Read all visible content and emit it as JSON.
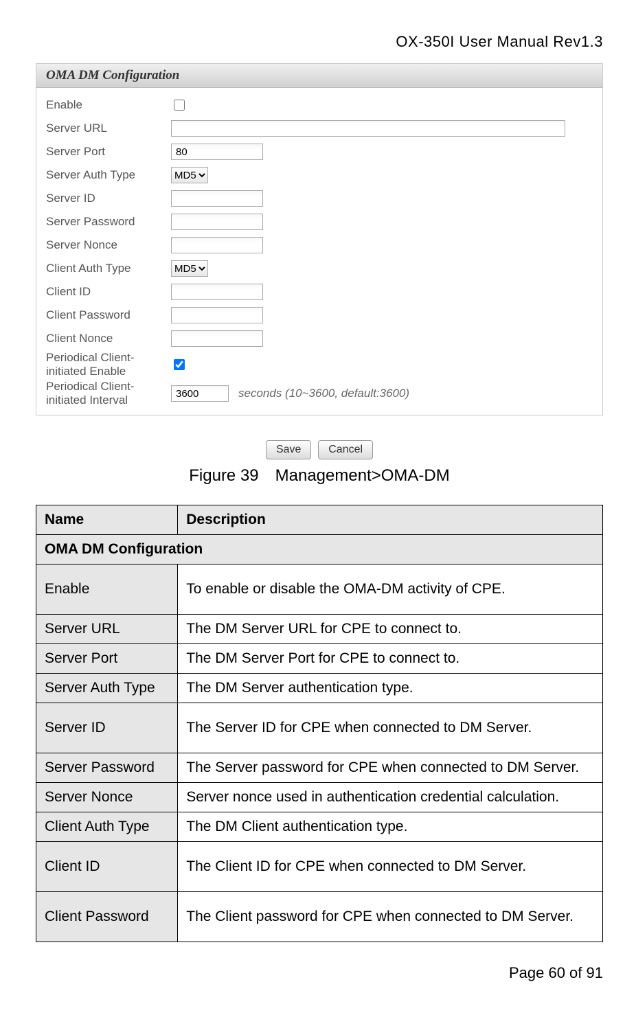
{
  "header": "OX-350I User Manual Rev1.3",
  "panel": {
    "title": "OMA DM Configuration",
    "rows": [
      {
        "label": "Enable"
      },
      {
        "label": "Server URL"
      },
      {
        "label": "Server Port",
        "value": "80"
      },
      {
        "label": "Server Auth Type",
        "select": "MD5"
      },
      {
        "label": "Server ID"
      },
      {
        "label": "Server Password"
      },
      {
        "label": "Server Nonce"
      },
      {
        "label": "Client Auth Type",
        "select": "MD5"
      },
      {
        "label": "Client ID"
      },
      {
        "label": "Client Password"
      },
      {
        "label": "Client Nonce"
      },
      {
        "label": "Periodical Client-initiated Enable"
      },
      {
        "label": "Periodical Client-initiated Interval",
        "value": "3600",
        "hint": "seconds (10~3600, default:3600)"
      }
    ],
    "buttons": {
      "save": "Save",
      "cancel": "Cancel"
    }
  },
  "caption": "Figure 39 Management>OMA-DM",
  "table": {
    "headers": {
      "name": "Name",
      "desc": "Description"
    },
    "section": "OMA DM Configuration",
    "rows": [
      {
        "name": "Enable",
        "desc": "To enable or disable the OMA-DM activity of CPE."
      },
      {
        "name": "Server URL",
        "desc": "The DM Server URL for CPE to connect to."
      },
      {
        "name": "Server Port",
        "desc": "The DM Server Port for CPE to connect to."
      },
      {
        "name": "Server Auth Type",
        "desc": "The DM Server authentication type."
      },
      {
        "name": "Server ID",
        "desc": "The Server ID for CPE when connected to DM Server."
      },
      {
        "name": "Server Password",
        "desc": "The Server password for CPE when connected to DM Server."
      },
      {
        "name": "Server Nonce",
        "desc": "Server nonce used in authentication credential calculation."
      },
      {
        "name": "Client Auth Type",
        "desc": "The DM Client authentication type."
      },
      {
        "name": "Client ID",
        "desc": "The Client ID for CPE when connected to DM Server."
      },
      {
        "name": "Client Password",
        "desc": "The Client password for CPE when connected to DM Server."
      }
    ]
  },
  "footer": "Page 60 of 91"
}
